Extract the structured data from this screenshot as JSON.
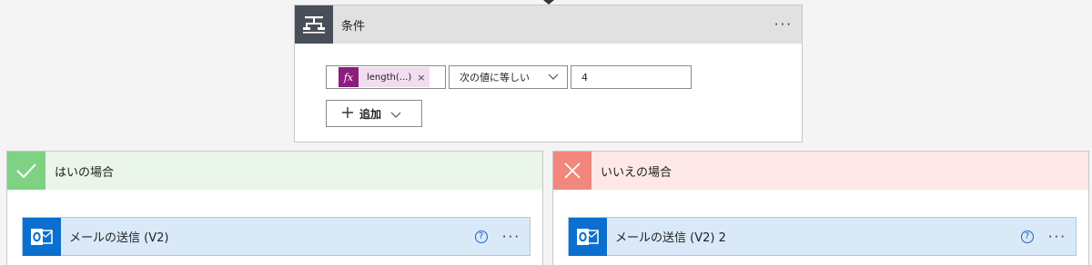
{
  "condition": {
    "title": "条件",
    "more_label": "···",
    "token_fx": "fx",
    "token_text": "length(...)",
    "token_remove": "×",
    "operator": "次の値に等しい",
    "value": "4",
    "add_label": "追加"
  },
  "branches": {
    "yes": {
      "title": "はいの場合",
      "action_title": "メールの送信 (V2)",
      "help_label": "?",
      "more_label": "···"
    },
    "no": {
      "title": "いいえの場合",
      "action_title": "メールの送信 (V2) 2",
      "help_label": "?",
      "more_label": "···"
    }
  },
  "colors": {
    "condition_icon_bg": "#484f58",
    "fx_token": "#8b1e7c",
    "yes_accent": "#7fd284",
    "no_accent": "#f1877e",
    "outlook_blue": "#0b6fcf"
  },
  "icons": {
    "condition": "condition-icon",
    "yes": "checkmark-icon",
    "no": "close-icon",
    "action": "outlook-icon"
  }
}
